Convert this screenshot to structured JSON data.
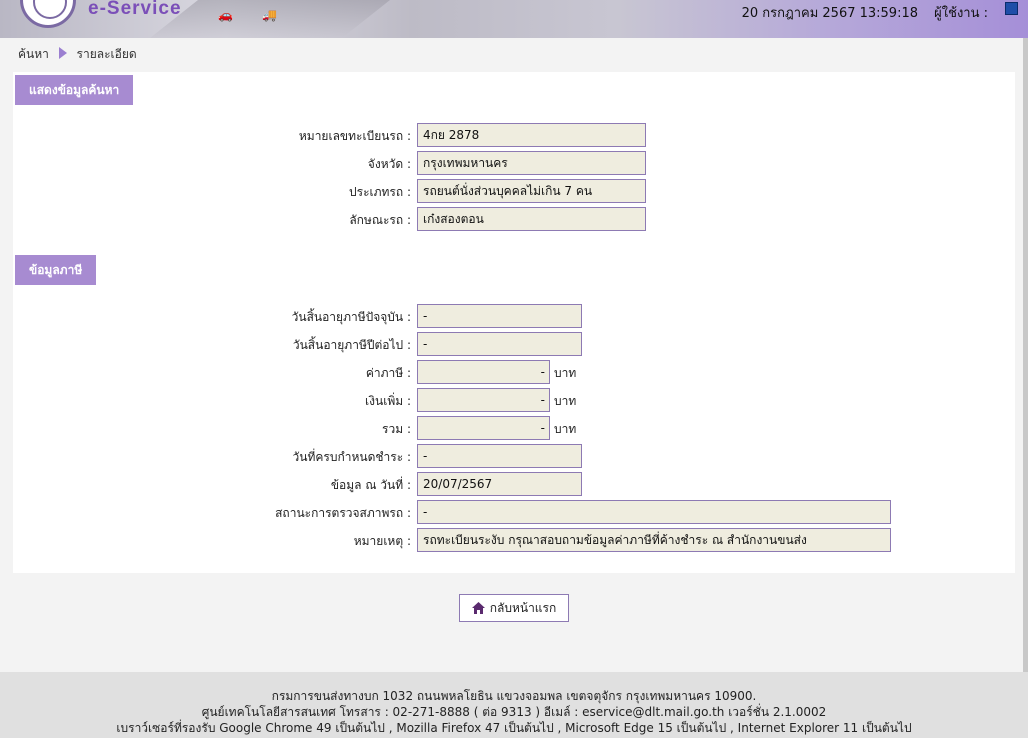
{
  "header": {
    "logo_text": "e-Service",
    "datetime": "20 กรกฎาคม 2567 13:59:18",
    "user_label": "ผู้ใช้งาน :"
  },
  "breadcrumb": {
    "search": "ค้นหา",
    "detail": "รายละเอียด"
  },
  "search_section": {
    "title": "แสดงข้อมูลค้นหา",
    "fields": [
      {
        "label": "หมายเลขทะเบียนรถ :",
        "value": "4กย 2878"
      },
      {
        "label": "จังหวัด :",
        "value": "กรุงเทพมหานคร"
      },
      {
        "label": "ประเภทรถ :",
        "value": "รถยนต์นั่งส่วนบุคคลไม่เกิน 7 คน"
      },
      {
        "label": "ลักษณะรถ :",
        "value": "เก๋งสองตอน"
      }
    ]
  },
  "tax_section": {
    "title": "ข้อมูลภาษี",
    "expire_current": {
      "label": "วันสิ้นอายุภาษีปัจจุบัน :",
      "value": "-"
    },
    "expire_next": {
      "label": "วันสิ้นอายุภาษีปีต่อไป :",
      "value": "-"
    },
    "tax_amount": {
      "label": "ค่าภาษี :",
      "value": "-",
      "unit": "บาท"
    },
    "surcharge": {
      "label": "เงินเพิ่ม :",
      "value": "-",
      "unit": "บาท"
    },
    "total": {
      "label": "รวม :",
      "value": "-",
      "unit": "บาท"
    },
    "due_date": {
      "label": "วันที่ครบกำหนดชำระ :",
      "value": "-"
    },
    "data_as_of": {
      "label": "ข้อมูล ณ วันที่ :",
      "value": "20/07/2567"
    },
    "inspection_status": {
      "label": "สถานะการตรวจสภาพรถ :",
      "value": "-"
    },
    "remark": {
      "label": "หมายเหตุ :",
      "value": "รถทะเบียนระงับ กรุณาสอบถามข้อมูลค่าภาษีที่ค้างชำระ ณ สำนักงานขนส่ง"
    }
  },
  "home_button": {
    "label": "กลับหน้าแรก"
  },
  "footer": {
    "line1": "กรมการขนส่งทางบก 1032 ถนนพหลโยธิน แขวงจอมพล เขตจตุจักร กรุงเทพมหานคร 10900.",
    "line2": "ศูนย์เทคโนโลยีสารสนเทศ โทรสาร : 02-271-8888 ( ต่อ 9313 ) อีเมล์ : eservice@dlt.mail.go.th เวอร์ชั่น 2.1.0002",
    "line3": "เบราว์เซอร์ที่รองรับ Google Chrome 49 เป็นต้นไป , Mozilla Firefox 47 เป็นต้นไป , Microsoft Edge 15 เป็นต้นไป , Internet Explorer 11 เป็นต้นไป"
  }
}
